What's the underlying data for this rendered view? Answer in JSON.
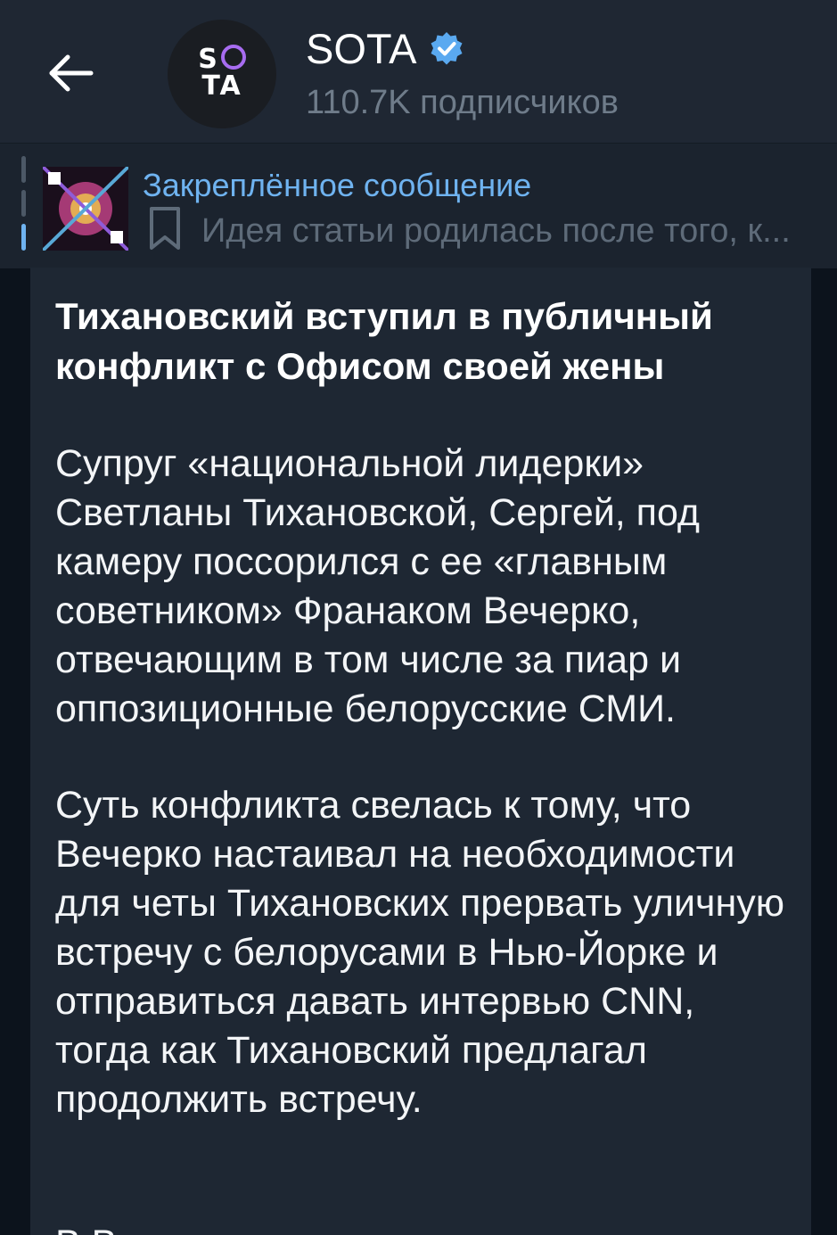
{
  "header": {
    "channel_name": "SOTA",
    "subscribers": "110.7K подписчиков",
    "avatar_logo": "SOTA"
  },
  "pinned": {
    "label": "Закреплённое сообщение",
    "preview": "Идея статьи родилась после того, к..."
  },
  "message": {
    "title": "Тихановский вступил в публичный конфликт с Офисом своей жены",
    "paragraph_1": "Супруг «национальной лидерки» Светланы Тихановской, Сергей, под камеру поссорился с ее «главным советником» Франаком Вечерко, отвечающим в том числе за пиар и оппозиционные белорусские СМИ.",
    "paragraph_2": "Суть конфликта свелась к тому, что Вечерко настаивал на необходимости для четы Тихановских прервать уличную встречу с белорусами в Нью-Йорке и отправиться давать интервью CNN, тогда как Тихановский предлагал продолжить встречу.",
    "cut_off_line": "В      В"
  },
  "colors": {
    "header_bg": "#1f2733",
    "pinned_bg": "#1b232e",
    "bubble_bg": "#1e2733",
    "accent": "#6fb3f0",
    "muted": "#6f7c8a",
    "verified": "#5aa9f0"
  },
  "icons": {
    "back": "arrow-left-icon",
    "verified": "verified-badge-icon",
    "bookmark": "bookmark-icon"
  }
}
